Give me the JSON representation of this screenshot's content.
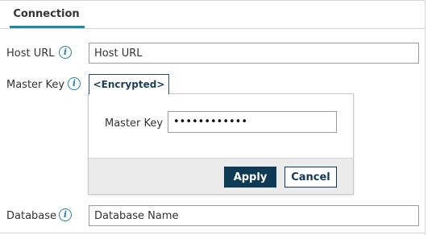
{
  "tabs": [
    {
      "label": "Connection",
      "active": true
    }
  ],
  "fields": {
    "host_url": {
      "label": "Host URL",
      "value": "Host URL",
      "info_icon": "info-icon"
    },
    "master_key": {
      "label": "Master Key",
      "button_label": "<Encrypted>",
      "info_icon": "info-icon"
    },
    "database": {
      "label": "Database",
      "value": "Database Name",
      "info_icon": "info-icon"
    }
  },
  "popup": {
    "label": "Master Key",
    "password_value": "••••••••••••",
    "apply_label": "Apply",
    "cancel_label": "Cancel"
  },
  "colors": {
    "accent": "#1a8aa3",
    "primary_button": "#0f3a56",
    "info_icon": "#2a7fa8"
  }
}
